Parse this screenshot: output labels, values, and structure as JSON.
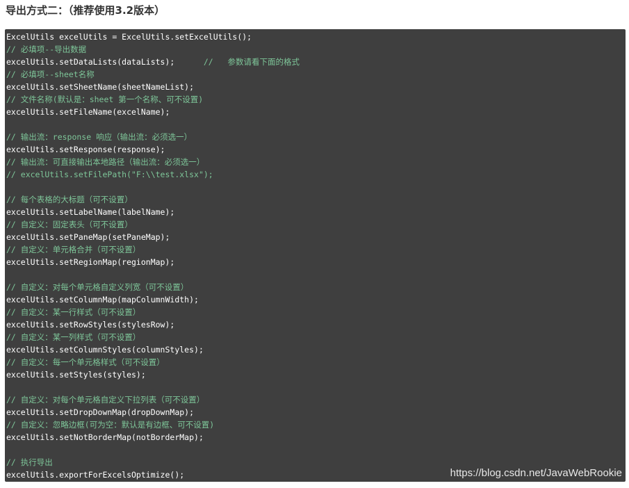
{
  "heading": "导出方式二：（推荐使用3.2版本）",
  "code": {
    "lines": [
      {
        "kind": "code",
        "text": "ExcelUtils excelUtils = ExcelUtils.setExcelUtils();"
      },
      {
        "kind": "comment",
        "text": "// 必填项--导出数据"
      },
      {
        "kind": "code",
        "text": "excelUtils.setDataLists(dataLists);      ",
        "comment": "//   参数请看下面的格式"
      },
      {
        "kind": "comment",
        "text": "// 必填项--sheet名称"
      },
      {
        "kind": "code",
        "text": "excelUtils.setSheetName(sheetNameList);"
      },
      {
        "kind": "comment",
        "text": "// 文件名称(默认是：sheet 第一个名称、可不设置)"
      },
      {
        "kind": "code",
        "text": "excelUtils.setFileName(excelName);"
      },
      {
        "kind": "blank",
        "text": ""
      },
      {
        "kind": "comment",
        "text": "// 输出流：response 响应（输出流：必须选一）"
      },
      {
        "kind": "code",
        "text": "excelUtils.setResponse(response);"
      },
      {
        "kind": "comment",
        "text": "// 输出流：可直接输出本地路径（输出流：必须选一）"
      },
      {
        "kind": "comment",
        "text": "// excelUtils.setFilePath(\"F:\\\\test.xlsx\");"
      },
      {
        "kind": "blank",
        "text": ""
      },
      {
        "kind": "comment",
        "text": "// 每个表格的大标题（可不设置）"
      },
      {
        "kind": "code",
        "text": "excelUtils.setLabelName(labelName);"
      },
      {
        "kind": "comment",
        "text": "// 自定义：固定表头（可不设置）"
      },
      {
        "kind": "code",
        "text": "excelUtils.setPaneMap(setPaneMap);"
      },
      {
        "kind": "comment",
        "text": "// 自定义：单元格合并（可不设置）"
      },
      {
        "kind": "code",
        "text": "excelUtils.setRegionMap(regionMap);"
      },
      {
        "kind": "blank",
        "text": ""
      },
      {
        "kind": "comment",
        "text": "// 自定义：对每个单元格自定义列宽（可不设置）"
      },
      {
        "kind": "code",
        "text": "excelUtils.setColumnMap(mapColumnWidth);"
      },
      {
        "kind": "comment",
        "text": "// 自定义：某一行样式（可不设置）"
      },
      {
        "kind": "code",
        "text": "excelUtils.setRowStyles(stylesRow);"
      },
      {
        "kind": "comment",
        "text": "// 自定义：某一列样式（可不设置）"
      },
      {
        "kind": "code",
        "text": "excelUtils.setColumnStyles(columnStyles);"
      },
      {
        "kind": "comment",
        "text": "// 自定义：每一个单元格样式（可不设置）"
      },
      {
        "kind": "code",
        "text": "excelUtils.setStyles(styles);"
      },
      {
        "kind": "blank",
        "text": ""
      },
      {
        "kind": "comment",
        "text": "// 自定义：对每个单元格自定义下拉列表（可不设置）"
      },
      {
        "kind": "code",
        "text": "excelUtils.setDropDownMap(dropDownMap);"
      },
      {
        "kind": "comment",
        "text": "// 自定义：忽略边框(可为空：默认是有边框、可不设置)"
      },
      {
        "kind": "code",
        "text": "excelUtils.setNotBorderMap(notBorderMap);"
      },
      {
        "kind": "blank",
        "text": ""
      },
      {
        "kind": "comment",
        "text": "// 执行导出"
      },
      {
        "kind": "code",
        "text": "excelUtils.exportForExcelsOptimize();"
      }
    ]
  },
  "watermark": "https://blog.csdn.net/JavaWebRookie",
  "colors": {
    "code_background": "#3f3f3f",
    "code_text": "#ffffff",
    "comment_text": "#7ec699",
    "heading_text": "#333333"
  }
}
